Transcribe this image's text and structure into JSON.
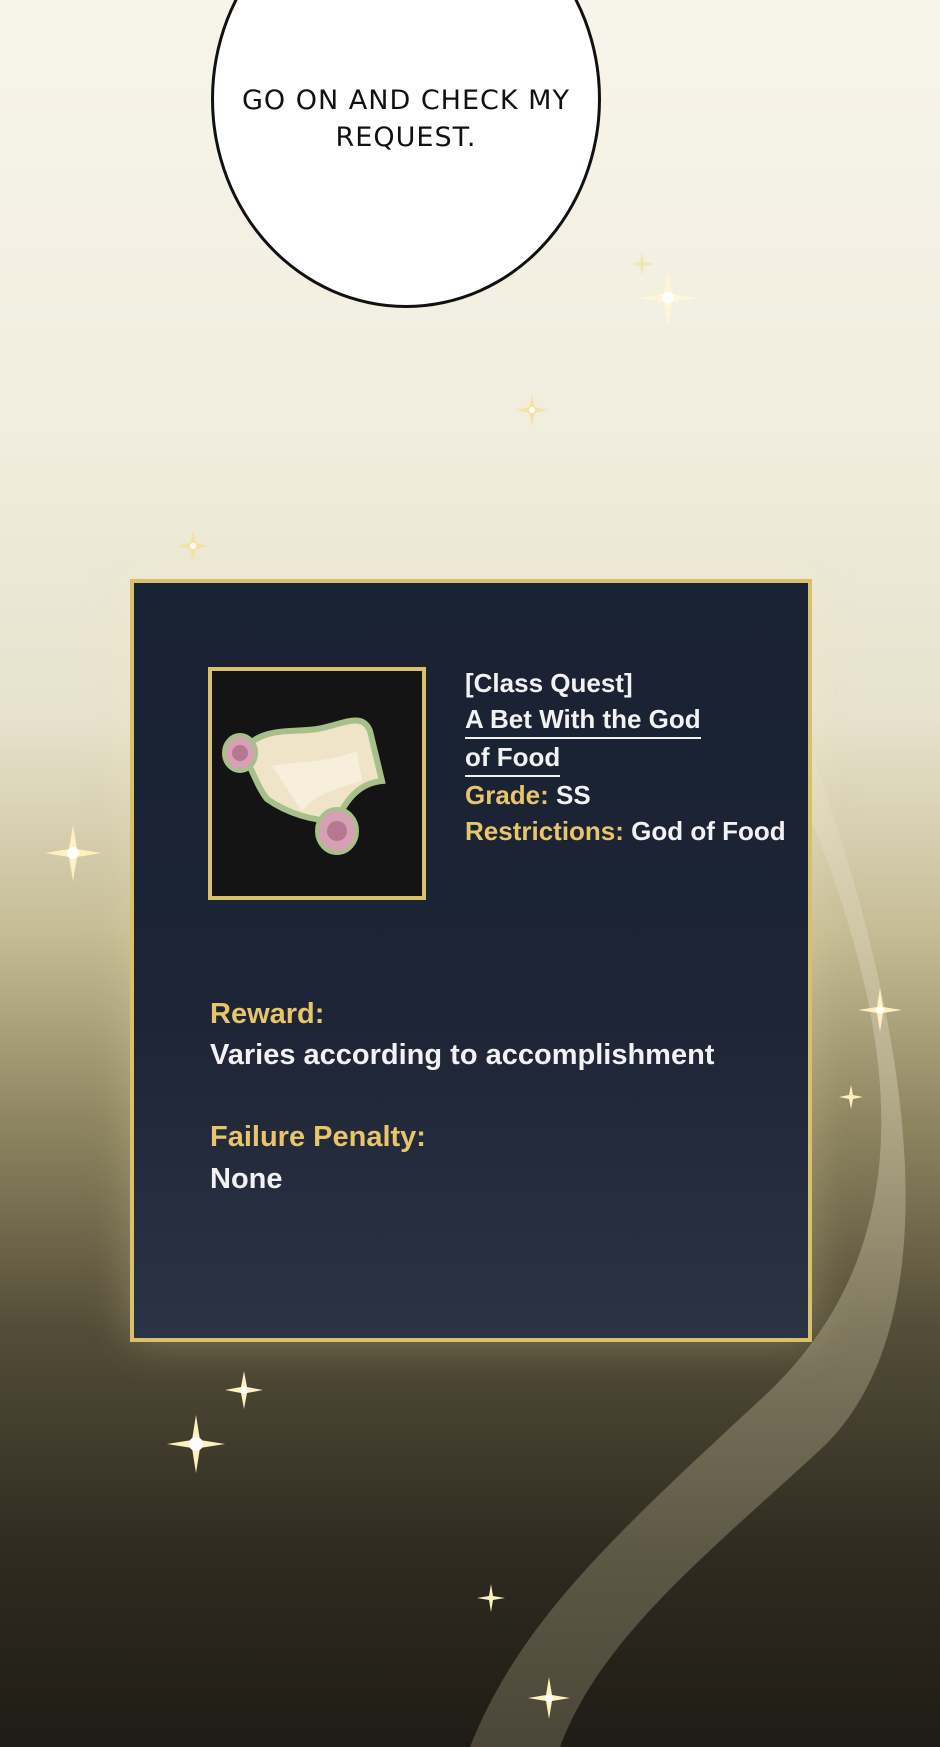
{
  "speech_bubble": {
    "text": "Go on and check my request."
  },
  "quest": {
    "category": "[Class Quest]",
    "title_line1": "A Bet With the God",
    "title_line2": "of Food",
    "grade_label": "Grade:",
    "grade_value": "SS",
    "restrictions_label": "Restrictions:",
    "restrictions_value": "God of Food",
    "reward_label": "Reward:",
    "reward_value": "Varies according to accomplishment",
    "penalty_label": "Failure Penalty:",
    "penalty_value": "None",
    "icon": "scroll-icon"
  },
  "colors": {
    "gold": "#e8c56a",
    "frame": "#d8c16a",
    "panel": "#192233",
    "text": "#f2f2f2"
  }
}
